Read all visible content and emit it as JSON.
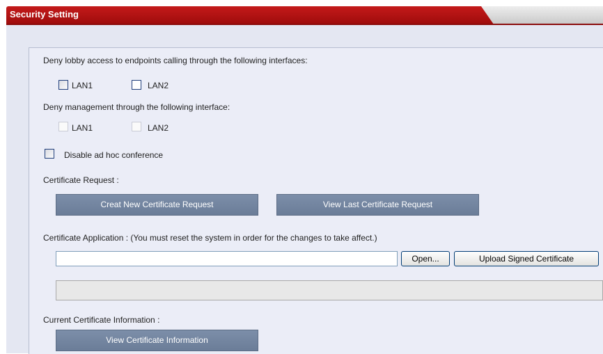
{
  "window": {
    "title": "Security Setting"
  },
  "lobby": {
    "label": "Deny lobby access to endpoints calling through the following interfaces:",
    "options": [
      {
        "label": "LAN1",
        "checked": false
      },
      {
        "label": "LAN2",
        "checked": false
      }
    ]
  },
  "management": {
    "label": "Deny management through the following interface:",
    "options": [
      {
        "label": "LAN1",
        "checked": false,
        "disabled": true
      },
      {
        "label": "LAN2",
        "checked": false,
        "disabled": true
      }
    ]
  },
  "adhoc": {
    "label": "Disable ad hoc conference",
    "checked": false
  },
  "cert_request": {
    "label": "Certificate Request :",
    "new_button": "Creat New Certificate Request",
    "view_button": "View Last Certificate Request"
  },
  "cert_application": {
    "label": "Certificate Application : (You must reset the system in order for the changes to take affect.)",
    "file_value": "",
    "open_button": "Open...",
    "upload_button": "Upload Signed Certificate",
    "status_text": ""
  },
  "current_cert": {
    "label": "Current Certificate Information :",
    "view_button": "View Certificate Information"
  },
  "colors": {
    "title_red": "#b01212",
    "panel_bg": "#e4e7f2",
    "button_blue": "#7485a0"
  }
}
